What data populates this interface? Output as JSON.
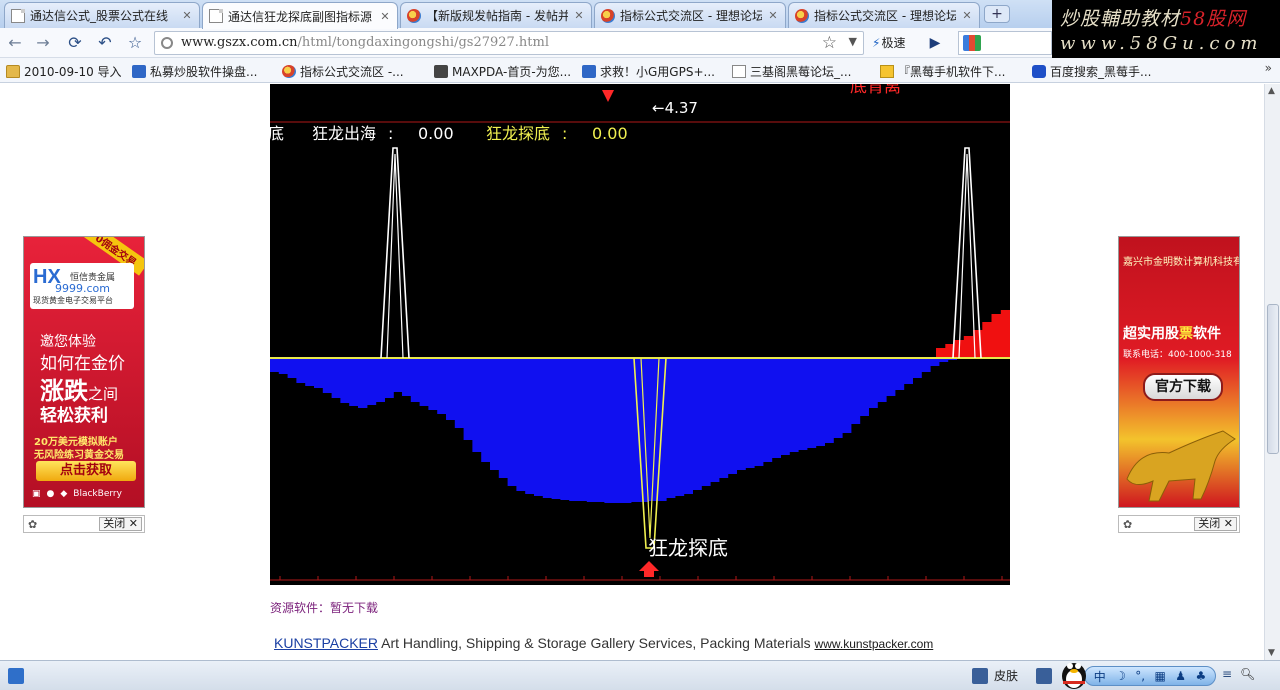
{
  "tabs": [
    {
      "label": "通达信公式_股票公式在线",
      "icon": "page",
      "active": false
    },
    {
      "label": "通达信狂龙探底副图指标源",
      "icon": "page",
      "active": true
    },
    {
      "label": "【新版规发帖指南 - 发帖并",
      "icon": "globe",
      "active": false
    },
    {
      "label": "指标公式交流区 - 理想论坛",
      "icon": "globe",
      "active": false
    },
    {
      "label": "指标公式交流区 - 理想论坛",
      "icon": "globe",
      "active": false
    }
  ],
  "new_tab_label": "+",
  "brand": {
    "line1_a": "炒股輔助教材",
    "line1_b": "58股网",
    "line2": "www.58Gu.com"
  },
  "toolbar": {
    "back": "←",
    "forward": "→",
    "reload": "⟳",
    "undo": "↶",
    "bookmark_star": "☆",
    "url_host": "www.gszx.com.cn",
    "url_path": "/html/tongdaxingongshi/gs27927.html",
    "speed_label": "极速"
  },
  "bookmarks": [
    {
      "label": "2010-09-10 导入",
      "icon": "folder"
    },
    {
      "label": "私募炒股软件操盘...",
      "icon": "blue"
    },
    {
      "label": "指标公式交流区 -...",
      "icon": "globe"
    },
    {
      "label": "MAXPDA-首页-为您...",
      "icon": "mono"
    },
    {
      "label": "求救！小G用GPS+...",
      "icon": "blue"
    },
    {
      "label": "三基阁黑莓论坛_...",
      "icon": "page"
    },
    {
      "label": "『黑莓手机软件下...",
      "icon": "mail"
    },
    {
      "label": "百度搜索_黑莓手...",
      "icon": "paw"
    }
  ],
  "bookmarks_more": "»",
  "chart_data": {
    "type": "bar",
    "title": "",
    "header_text": "底背离",
    "price_label": "←4.37",
    "indicators": [
      {
        "name": "狂龙出海",
        "value": "0.00",
        "color": "#ffffff"
      },
      {
        "name": "狂龙探底",
        "value": "0.00",
        "color": "#f0f050"
      }
    ],
    "left_cut_label": "底",
    "signal_label": "狂龙探底",
    "zero_line_color": "#e8e84a",
    "blue_bars": [
      14,
      16,
      20,
      25,
      28,
      30,
      35,
      40,
      45,
      48,
      50,
      47,
      44,
      40,
      34,
      38,
      44,
      48,
      52,
      56,
      62,
      70,
      82,
      94,
      104,
      112,
      120,
      128,
      133,
      136,
      138,
      140,
      141,
      142,
      143,
      143,
      144,
      144,
      145,
      145,
      145,
      144,
      144,
      143,
      143,
      140,
      138,
      136,
      132,
      128,
      124,
      120,
      116,
      112,
      110,
      108,
      104,
      100,
      97,
      94,
      92,
      90,
      88,
      85,
      80,
      75,
      66,
      58,
      50,
      44,
      38,
      32,
      26,
      20,
      14,
      8,
      4,
      2
    ],
    "red_bars": [
      10,
      14,
      18,
      22,
      28,
      36,
      44,
      48
    ],
    "white_spikes": [
      {
        "center": 125,
        "height": 210
      },
      {
        "center": 697,
        "height": 210
      }
    ],
    "yellow_spike_center": 380
  },
  "resource": {
    "label": "资源软件：",
    "value": "暂无下载"
  },
  "ad_line": {
    "link": "KUNSTPACKER",
    "text": " Art Handling, Shipping & Storage Gallery Services, Packing Materials ",
    "url": "www.kunstpacker.com"
  },
  "ad_left": {
    "badge": "0佣金交易",
    "logo": "HX",
    "logo_sub": "恒信贵金属",
    "logo_domain": "9999.com",
    "logo_tag": "现货黄金电子交易平台",
    "l1": "邀您体验",
    "l2": "如何在金价",
    "l3": "涨跌",
    "l3b": "之间",
    "l4": "轻松获利",
    "l5": "20万美元模拟账户",
    "l6": "无风险练习黄金交易",
    "cta": "点击获取",
    "os": "BlackBerry"
  },
  "ad_right": {
    "title": "嘉兴市金明数计算机科技有限公司",
    "big_a": "超实用股",
    "big_b": "票",
    "big_c": "软件",
    "phone": "联系电话：400-1000-318",
    "cta": "官方下载"
  },
  "close_label": "关闭",
  "status": {
    "skin": "皮肤",
    "ime": [
      "中",
      "☽",
      "°,",
      "▦",
      "♟",
      "♣"
    ]
  }
}
